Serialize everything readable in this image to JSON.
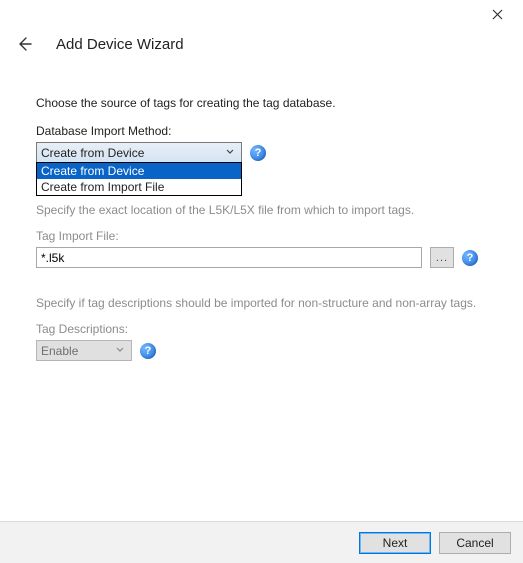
{
  "window": {
    "title": "Add Device Wizard"
  },
  "intro": "Choose the source of tags for creating the tag database.",
  "import_method": {
    "label": "Database Import Method:",
    "value": "Create from Device",
    "options": [
      "Create from Device",
      "Create from Import File"
    ]
  },
  "file_hint": "Specify the exact location of the L5K/L5X file from which to import tags.",
  "tag_file": {
    "label": "Tag Import File:",
    "value": "*.l5k",
    "browse": "..."
  },
  "tag_desc_hint": "Specify if tag descriptions should be imported for non-structure and non-array tags.",
  "tag_desc": {
    "label": "Tag Descriptions:",
    "value": "Enable"
  },
  "buttons": {
    "next": "Next",
    "cancel": "Cancel"
  },
  "icons": {
    "help": "?"
  }
}
